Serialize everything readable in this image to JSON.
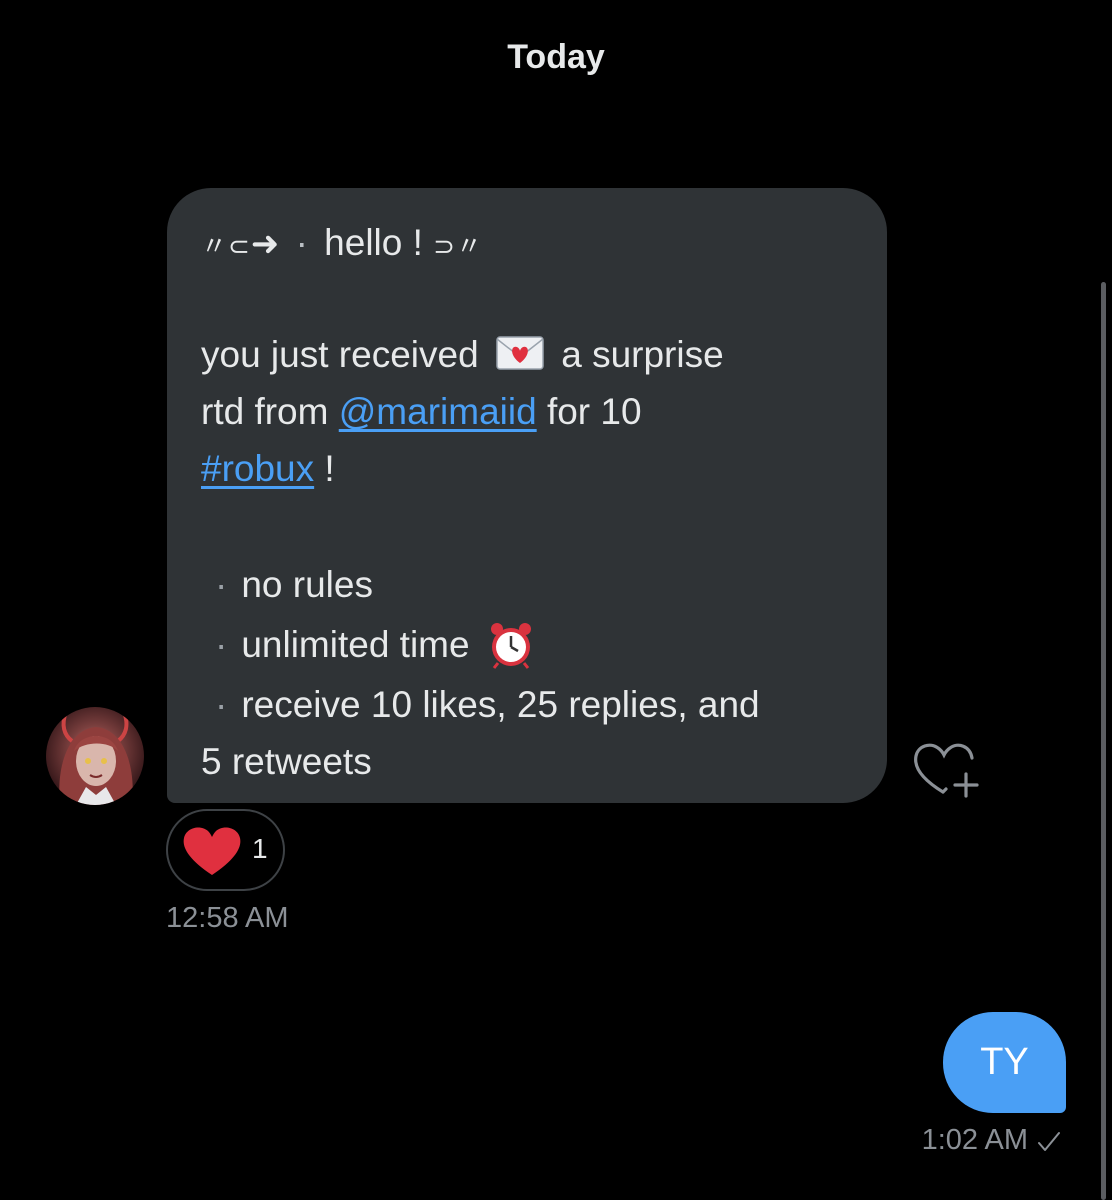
{
  "header": {
    "date_label": "Today"
  },
  "incoming_message": {
    "line1": {
      "prefix": "〃⊂",
      "arrow": "➜",
      "dot": "·",
      "text": " hello ! ",
      "suffix": "⊃〃"
    },
    "line2_a": "you just received ",
    "line2_emoji": "love-letter-emoji",
    "line2_b": " a surprise",
    "line3_a": "rtd from ",
    "line3_mention": "@marimaiid",
    "line3_b": " for 10",
    "line4_hashtag": "#robux",
    "line4_b": " !",
    "bullet": "·",
    "bullet1": "no rules",
    "bullet2": "unlimited time ",
    "bullet2_emoji": "alarm-clock-emoji",
    "bullet3": "receive 10 likes, 25 replies, and",
    "bullet3_cont": "5 retweets",
    "reaction_count": "1",
    "timestamp": "12:58 AM"
  },
  "outgoing_message": {
    "text": "TY",
    "timestamp": "1:02 AM"
  },
  "colors": {
    "background": "#000000",
    "incoming_bubble": "#2f3336",
    "outgoing_bubble": "#4a9ff5",
    "link": "#4a9ff5",
    "heart": "#e0303f",
    "muted_text": "#8b9096"
  },
  "icons": {
    "avatar": "user-avatar",
    "add_reaction": "heart-plus-icon",
    "reaction": "heart-icon",
    "read_status": "check-icon"
  }
}
